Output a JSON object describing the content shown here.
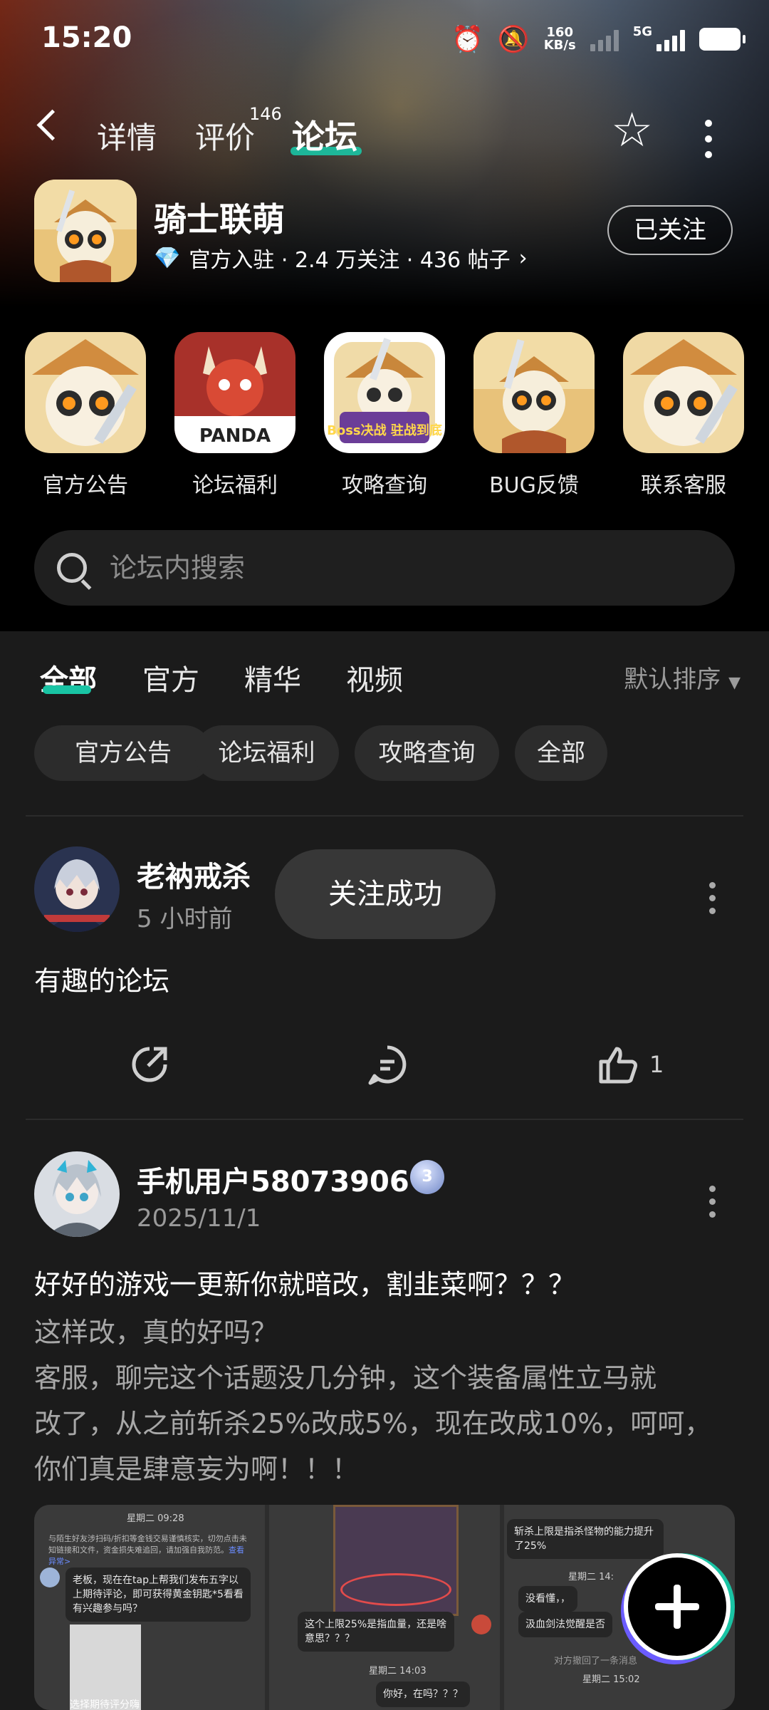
{
  "status_bar": {
    "time": "15:20",
    "net_speed_value": "160",
    "net_speed_unit": "KB/s",
    "signal_label": "5G"
  },
  "nav": {
    "tabs": [
      "详情",
      "评价",
      "论坛"
    ],
    "active": "论坛",
    "review_count": "146"
  },
  "app": {
    "name": "骑士联萌",
    "meta": "官方入驻 · 2.4 万关注 · 436 帖子",
    "follow_label": "已关注"
  },
  "shortcuts": [
    {
      "label": "官方公告"
    },
    {
      "label": "论坛福利",
      "tile_text": "PANDA"
    },
    {
      "label": "攻略查询",
      "tile_text": "Boss决战 驻战到底"
    },
    {
      "label": "BUG反馈"
    },
    {
      "label": "联系客服"
    }
  ],
  "search": {
    "placeholder": "论坛内搜索"
  },
  "filter_tabs": [
    "全部",
    "官方",
    "精华",
    "视频"
  ],
  "sort_label": "默认排序",
  "chips": [
    "官方公告",
    "论坛福利",
    "攻略查询",
    "全部"
  ],
  "toast": "关注成功",
  "posts": [
    {
      "author": "老衲戒杀",
      "time": "5 小时前",
      "title": "有趣的论坛",
      "like_count": "1"
    },
    {
      "author": "手机用户58073906",
      "level": "3",
      "time": "2025/11/1",
      "title": "好好的游戏一更新你就暗改，割韭菜啊？？？",
      "body_lines": [
        "这样改，真的好吗？",
        "客服，聊完这个话题没几分钟，这个装备属性立马就",
        "改了，从之前斩杀25%改成5%，现在改成10%，呵呵，",
        "你们真是肆意妄为啊！！！"
      ],
      "images": {
        "a_time": "星期二 09:28",
        "a_notice": "与陌生好友涉扫码/折扣等金钱交易谨慎核实，切勿点击未知链接和文件，资金损失难追回，请加强自我防范。",
        "a_notice_link": "查看异常>",
        "a_bubble": "老板，现在在tap上帮我们发布五字以上期待评论，即可获得黄金钥匙*5看看有兴趣参与吗？",
        "a_footer": "选择期待评分嗨",
        "b_bubble": "这个上限25%是指血量，还是啥意思？？？",
        "b_time": "星期二 14:03",
        "b_bubble2": "你好，在吗？？？",
        "c_top": "斩杀上限是指杀怪物的能力提升了25%",
        "c_time": "星期二 14:",
        "c_bubble": "没看懂，，",
        "c_bubble2": "汲血剑法觉醒是否",
        "c_sys": "对方撤回了一条消息",
        "c_time2": "星期二 15:02"
      }
    }
  ]
}
